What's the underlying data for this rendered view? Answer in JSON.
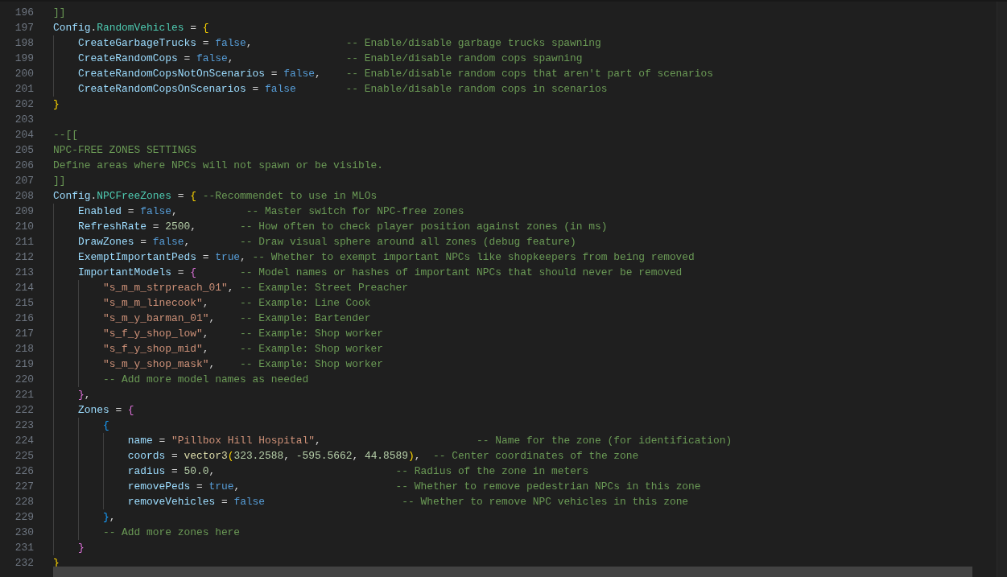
{
  "editor": {
    "lines": [
      {
        "number": "196",
        "tokens": [
          {
            "kind": "comment",
            "text": "]]"
          }
        ]
      },
      {
        "number": "197",
        "tokens": [
          {
            "kind": "var",
            "text": "Config"
          },
          {
            "kind": "op",
            "text": "."
          },
          {
            "kind": "field",
            "text": "RandomVehicles"
          },
          {
            "kind": "op",
            "text": " = "
          },
          {
            "kind": "brace1",
            "text": "{"
          }
        ]
      },
      {
        "number": "198",
        "tokens": [
          {
            "kind": "var",
            "text": "    CreateGarbageTrucks"
          },
          {
            "kind": "op",
            "text": " = "
          },
          {
            "kind": "bool",
            "text": "false"
          },
          {
            "kind": "op",
            "text": ",               "
          },
          {
            "kind": "comment",
            "text": "-- Enable/disable garbage trucks spawning"
          }
        ]
      },
      {
        "number": "199",
        "tokens": [
          {
            "kind": "var",
            "text": "    CreateRandomCops"
          },
          {
            "kind": "op",
            "text": " = "
          },
          {
            "kind": "bool",
            "text": "false"
          },
          {
            "kind": "op",
            "text": ",                  "
          },
          {
            "kind": "comment",
            "text": "-- Enable/disable random cops spawning"
          }
        ]
      },
      {
        "number": "200",
        "tokens": [
          {
            "kind": "var",
            "text": "    CreateRandomCopsNotOnScenarios"
          },
          {
            "kind": "op",
            "text": " = "
          },
          {
            "kind": "bool",
            "text": "false"
          },
          {
            "kind": "op",
            "text": ",    "
          },
          {
            "kind": "comment",
            "text": "-- Enable/disable random cops that aren't part of scenarios"
          }
        ]
      },
      {
        "number": "201",
        "tokens": [
          {
            "kind": "var",
            "text": "    CreateRandomCopsOnScenarios"
          },
          {
            "kind": "op",
            "text": " = "
          },
          {
            "kind": "bool",
            "text": "false"
          },
          {
            "kind": "comment",
            "text": "        -- Enable/disable random cops in scenarios"
          }
        ]
      },
      {
        "number": "202",
        "tokens": [
          {
            "kind": "brace1",
            "text": "}"
          }
        ]
      },
      {
        "number": "203"
      },
      {
        "number": "204",
        "tokens": [
          {
            "kind": "comment",
            "text": "--[["
          }
        ]
      },
      {
        "number": "205",
        "tokens": [
          {
            "kind": "comment",
            "text": "NPC-FREE ZONES SETTINGS"
          }
        ]
      },
      {
        "number": "206",
        "tokens": [
          {
            "kind": "comment",
            "text": "Define areas where NPCs will not spawn or be visible."
          }
        ]
      },
      {
        "number": "207",
        "tokens": [
          {
            "kind": "comment",
            "text": "]]"
          }
        ]
      },
      {
        "number": "208",
        "tokens": [
          {
            "kind": "var",
            "text": "Config"
          },
          {
            "kind": "op",
            "text": "."
          },
          {
            "kind": "field",
            "text": "NPCFreeZones"
          },
          {
            "kind": "op",
            "text": " = "
          },
          {
            "kind": "brace1",
            "text": "{"
          },
          {
            "kind": "comment",
            "text": " --Recommendet to use in MLOs"
          }
        ]
      },
      {
        "number": "209",
        "tokens": [
          {
            "kind": "var",
            "text": "    Enabled"
          },
          {
            "kind": "op",
            "text": " = "
          },
          {
            "kind": "bool",
            "text": "false"
          },
          {
            "kind": "op",
            "text": ",           "
          },
          {
            "kind": "comment",
            "text": "-- Master switch for NPC-free zones"
          }
        ]
      },
      {
        "number": "210",
        "tokens": [
          {
            "kind": "var",
            "text": "    RefreshRate"
          },
          {
            "kind": "op",
            "text": " = "
          },
          {
            "kind": "num",
            "text": "2500"
          },
          {
            "kind": "op",
            "text": ",       "
          },
          {
            "kind": "comment",
            "text": "-- How often to check player position against zones (in ms)"
          }
        ]
      },
      {
        "number": "211",
        "tokens": [
          {
            "kind": "var",
            "text": "    DrawZones"
          },
          {
            "kind": "op",
            "text": " = "
          },
          {
            "kind": "bool",
            "text": "false"
          },
          {
            "kind": "op",
            "text": ",        "
          },
          {
            "kind": "comment",
            "text": "-- Draw visual sphere around all zones (debug feature)"
          }
        ]
      },
      {
        "number": "212",
        "tokens": [
          {
            "kind": "var",
            "text": "    ExemptImportantPeds"
          },
          {
            "kind": "op",
            "text": " = "
          },
          {
            "kind": "bool",
            "text": "true"
          },
          {
            "kind": "op",
            "text": ", "
          },
          {
            "kind": "comment",
            "text": "-- Whether to exempt important NPCs like shopkeepers from being removed"
          }
        ]
      },
      {
        "number": "213",
        "tokens": [
          {
            "kind": "var",
            "text": "    ImportantModels"
          },
          {
            "kind": "op",
            "text": " = "
          },
          {
            "kind": "brace2",
            "text": "{"
          },
          {
            "kind": "comment",
            "text": "       -- Model names or hashes of important NPCs that should never be removed"
          }
        ]
      },
      {
        "number": "214",
        "tokens": [
          {
            "kind": "str",
            "text": "        \"s_m_m_strpreach_01\""
          },
          {
            "kind": "op",
            "text": ", "
          },
          {
            "kind": "comment",
            "text": "-- Example: Street Preacher"
          }
        ]
      },
      {
        "number": "215",
        "tokens": [
          {
            "kind": "str",
            "text": "        \"s_m_m_linecook\""
          },
          {
            "kind": "op",
            "text": ",     "
          },
          {
            "kind": "comment",
            "text": "-- Example: Line Cook"
          }
        ]
      },
      {
        "number": "216",
        "tokens": [
          {
            "kind": "str",
            "text": "        \"s_m_y_barman_01\""
          },
          {
            "kind": "op",
            "text": ",    "
          },
          {
            "kind": "comment",
            "text": "-- Example: Bartender"
          }
        ]
      },
      {
        "number": "217",
        "tokens": [
          {
            "kind": "str",
            "text": "        \"s_f_y_shop_low\""
          },
          {
            "kind": "op",
            "text": ",     "
          },
          {
            "kind": "comment",
            "text": "-- Example: Shop worker"
          }
        ]
      },
      {
        "number": "218",
        "tokens": [
          {
            "kind": "str",
            "text": "        \"s_f_y_shop_mid\""
          },
          {
            "kind": "op",
            "text": ",     "
          },
          {
            "kind": "comment",
            "text": "-- Example: Shop worker"
          }
        ]
      },
      {
        "number": "219",
        "tokens": [
          {
            "kind": "str",
            "text": "        \"s_m_y_shop_mask\""
          },
          {
            "kind": "op",
            "text": ",    "
          },
          {
            "kind": "comment",
            "text": "-- Example: Shop worker"
          }
        ]
      },
      {
        "number": "220",
        "tokens": [
          {
            "kind": "comment",
            "text": "        -- Add more model names as needed"
          }
        ]
      },
      {
        "number": "221",
        "tokens": [
          {
            "kind": "brace2",
            "text": "    }"
          },
          {
            "kind": "op",
            "text": ","
          }
        ]
      },
      {
        "number": "222",
        "tokens": [
          {
            "kind": "var",
            "text": "    Zones"
          },
          {
            "kind": "op",
            "text": " = "
          },
          {
            "kind": "brace2",
            "text": "{"
          }
        ]
      },
      {
        "number": "223",
        "tokens": [
          {
            "kind": "brace3",
            "text": "        {"
          }
        ]
      },
      {
        "number": "224",
        "tokens": [
          {
            "kind": "var",
            "text": "            name"
          },
          {
            "kind": "op",
            "text": " = "
          },
          {
            "kind": "str",
            "text": "\"Pillbox Hill Hospital\""
          },
          {
            "kind": "op",
            "text": ",                         "
          },
          {
            "kind": "comment",
            "text": "-- Name for the zone (for identification)"
          }
        ]
      },
      {
        "number": "225",
        "tokens": [
          {
            "kind": "var",
            "text": "            coords"
          },
          {
            "kind": "op",
            "text": " = "
          },
          {
            "kind": "fn",
            "text": "vector3"
          },
          {
            "kind": "brace1",
            "text": "("
          },
          {
            "kind": "num",
            "text": "323.2588"
          },
          {
            "kind": "op",
            "text": ", "
          },
          {
            "kind": "num",
            "text": "-595.5662"
          },
          {
            "kind": "op",
            "text": ", "
          },
          {
            "kind": "num",
            "text": "44.8589"
          },
          {
            "kind": "brace1",
            "text": ")"
          },
          {
            "kind": "op",
            "text": ",  "
          },
          {
            "kind": "comment",
            "text": "-- Center coordinates of the zone"
          }
        ]
      },
      {
        "number": "226",
        "tokens": [
          {
            "kind": "var",
            "text": "            radius"
          },
          {
            "kind": "op",
            "text": " = "
          },
          {
            "kind": "num",
            "text": "50.0"
          },
          {
            "kind": "op",
            "text": ",                             "
          },
          {
            "kind": "comment",
            "text": "-- Radius of the zone in meters"
          }
        ]
      },
      {
        "number": "227",
        "tokens": [
          {
            "kind": "var",
            "text": "            removePeds"
          },
          {
            "kind": "op",
            "text": " = "
          },
          {
            "kind": "bool",
            "text": "true"
          },
          {
            "kind": "op",
            "text": ",                         "
          },
          {
            "kind": "comment",
            "text": "-- Whether to remove pedestrian NPCs in this zone"
          }
        ]
      },
      {
        "number": "228",
        "tokens": [
          {
            "kind": "var",
            "text": "            removeVehicles"
          },
          {
            "kind": "op",
            "text": " = "
          },
          {
            "kind": "bool",
            "text": "false"
          },
          {
            "kind": "comment",
            "text": "                      -- Whether to remove NPC vehicles in this zone"
          }
        ]
      },
      {
        "number": "229",
        "tokens": [
          {
            "kind": "brace3",
            "text": "        }"
          },
          {
            "kind": "op",
            "text": ","
          }
        ]
      },
      {
        "number": "230",
        "tokens": [
          {
            "kind": "comment",
            "text": "        -- Add more zones here"
          }
        ]
      },
      {
        "number": "231",
        "tokens": [
          {
            "kind": "brace2",
            "text": "    }"
          }
        ]
      },
      {
        "number": "232",
        "tokens": [
          {
            "kind": "brace1",
            "text": "}"
          }
        ]
      }
    ]
  }
}
